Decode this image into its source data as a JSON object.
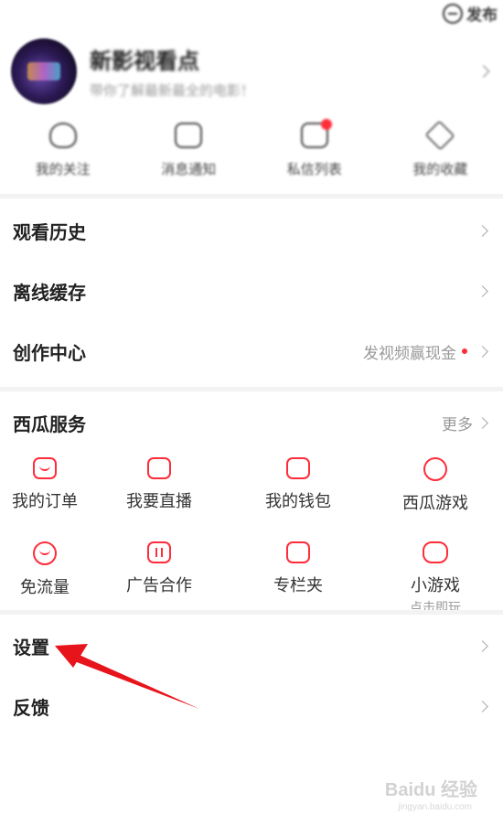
{
  "top": {
    "publish_label": "发布"
  },
  "profile": {
    "name": "新影视看点",
    "subtitle": "带你了解最新最全的电影！"
  },
  "quick": [
    {
      "label": "我的关注",
      "icon": "heart-icon"
    },
    {
      "label": "消息通知",
      "icon": "message-icon"
    },
    {
      "label": "私信列表",
      "icon": "chat-icon",
      "badge": true
    },
    {
      "label": "我的收藏",
      "icon": "home-icon"
    }
  ],
  "rows": {
    "history": "观看历史",
    "offline": "离线缓存",
    "creator": "创作中心",
    "creator_extra": "发视频赢现金",
    "settings": "设置",
    "feedback": "反馈"
  },
  "services": {
    "title": "西瓜服务",
    "more": "更多",
    "row1": [
      {
        "label": "我的订单",
        "icon": "order-icon"
      },
      {
        "label": "我要直播",
        "icon": "live-camera-icon"
      },
      {
        "label": "我的钱包",
        "icon": "wallet-icon"
      },
      {
        "label": "西瓜游戏",
        "icon": "game-icon"
      }
    ],
    "row2": [
      {
        "label": "免流量",
        "icon": "free-data-icon"
      },
      {
        "label": "广告合作",
        "icon": "ad-icon"
      },
      {
        "label": "专栏夹",
        "icon": "column-icon"
      },
      {
        "label": "小游戏",
        "sub": "点击即玩",
        "icon": "gamepad-icon"
      }
    ]
  },
  "colors": {
    "accent": "#ff2d3a",
    "divider": "#f3f3f3",
    "arrow": "#e8141c"
  },
  "watermark": {
    "text": "Baidu 经验",
    "sub": "jingyan.baidu.com"
  }
}
